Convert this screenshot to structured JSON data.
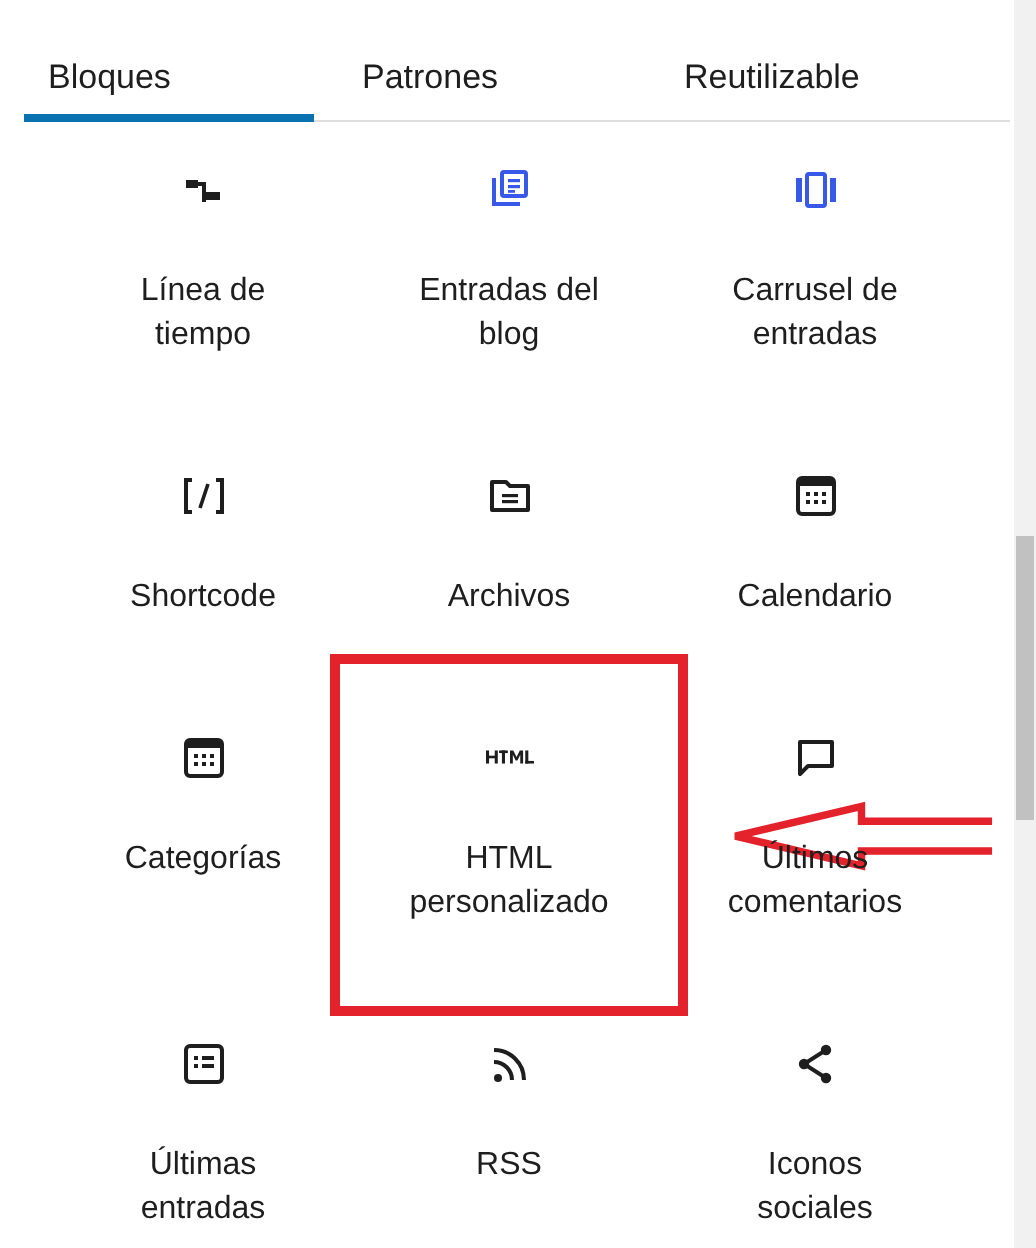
{
  "tabs": [
    {
      "label": "Bloques",
      "selected": true
    },
    {
      "label": "Patrones",
      "selected": false
    },
    {
      "label": "Reutilizable",
      "selected": false
    }
  ],
  "blocks": [
    {
      "label": "Línea de tiempo",
      "highlighted": false
    },
    {
      "label": "Entradas del blog",
      "highlighted": false
    },
    {
      "label": "Carrusel de entradas",
      "highlighted": false
    },
    {
      "label": "Shortcode",
      "highlighted": false
    },
    {
      "label": "Archivos",
      "highlighted": false
    },
    {
      "label": "Calendario",
      "highlighted": false
    },
    {
      "label": "Categorías",
      "highlighted": false
    },
    {
      "label": "HTML personalizado",
      "highlighted": true
    },
    {
      "label": "Últimos comentarios",
      "highlighted": false
    },
    {
      "label": "Últimas entradas",
      "highlighted": false
    },
    {
      "label": "RSS",
      "highlighted": false
    },
    {
      "label": "Iconos sociales",
      "highlighted": false
    }
  ],
  "callout_arrow": true
}
